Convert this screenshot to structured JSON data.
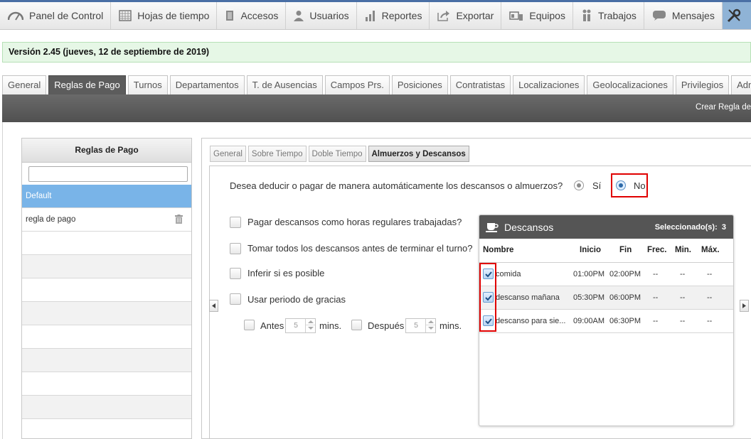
{
  "nav": {
    "items": [
      {
        "label": "Panel de Control",
        "icon": "dashboard-icon"
      },
      {
        "label": "Hojas de tiempo",
        "icon": "calendar-icon"
      },
      {
        "label": "Accesos",
        "icon": "door-icon"
      },
      {
        "label": "Usuarios",
        "icon": "user-icon"
      },
      {
        "label": "Reportes",
        "icon": "bar-chart-icon"
      },
      {
        "label": "Exportar",
        "icon": "export-arrow-icon"
      },
      {
        "label": "Equipos",
        "icon": "team-icon"
      },
      {
        "label": "Trabajos",
        "icon": "workers-icon"
      },
      {
        "label": "Mensajes",
        "icon": "chat-bubble-icon"
      }
    ],
    "tools_icon": "wrench-screwdriver-icon"
  },
  "version_text": "Versión 2.45 (jueves, 12 de septiembre de 2019)",
  "main_tabs": [
    "General",
    "Reglas de Pago",
    "Turnos",
    "Departamentos",
    "T. de Ausencias",
    "Campos Prs.",
    "Posiciones",
    "Contratistas",
    "Localizaciones",
    "Geolocalizaciones",
    "Privilegios",
    "Admins"
  ],
  "active_main_tab": "Reglas de Pago",
  "create_rule_label": "Crear Regla de",
  "left_panel": {
    "title": "Reglas de Pago",
    "search_value": "",
    "rules": [
      {
        "name": "Default",
        "selected": true
      },
      {
        "name": "regla de pago",
        "selected": false
      }
    ]
  },
  "sub_tabs": [
    "General",
    "Sobre Tiempo",
    "Doble Tiempo",
    "Almuerzos y Descansos"
  ],
  "active_sub_tab": "Almuerzos y Descansos",
  "form": {
    "question": "Desea deducir o pagar de manera automáticamente los descansos o almuerzos?",
    "radio_yes": "Sí",
    "radio_no": "No",
    "selected_option": "No",
    "options": [
      "Pagar descansos como horas regulares trabajadas?",
      "Tomar todos los descansos antes de terminar el turno?",
      "Inferir si es posible",
      "Usar periodo de gracias"
    ],
    "grace": {
      "before_label": "Antes",
      "before_value": "5",
      "after_label": "Después",
      "after_value": "5",
      "unit": "mins."
    }
  },
  "descansos": {
    "title": "Descansos",
    "selected_label": "Seleccionado(s):",
    "selected_count": "3",
    "columns": [
      "Nombre",
      "Inicio",
      "Fin",
      "Frec.",
      "Min.",
      "Máx."
    ],
    "rows": [
      {
        "name": "comida",
        "start": "01:00PM",
        "end": "02:00PM",
        "freq": "--",
        "min": "--",
        "max": "--",
        "checked": true
      },
      {
        "name": "descanso mañana",
        "start": "05:30PM",
        "end": "06:00PM",
        "freq": "--",
        "min": "--",
        "max": "--",
        "checked": true
      },
      {
        "name": "descanso para sie...",
        "start": "09:00AM",
        "end": "06:30PM",
        "freq": "--",
        "min": "--",
        "max": "--",
        "checked": true
      }
    ]
  },
  "colors": {
    "accent_blue": "#79b4e8",
    "dark_bar": "#555555",
    "highlight_red": "#e00000",
    "version_bg": "#e6f7e6"
  }
}
